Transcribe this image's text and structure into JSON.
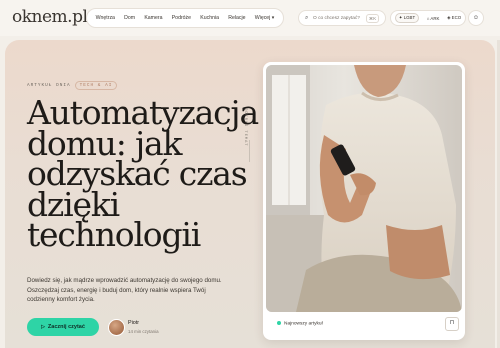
{
  "header": {
    "logo": "oknem.pl",
    "nav": [
      "Wnętrza",
      "Dom",
      "Kamera",
      "Podróże",
      "Kuchnia",
      "Relacje",
      "Więcej ▾"
    ],
    "search_placeholder": "O co chcesz zapytać?",
    "search_shortcut": "⌘K",
    "quick_pills": [
      "LGBT",
      "ARK",
      "ECO"
    ],
    "icons": [
      "search-icon",
      "sparkle-icon",
      "user-icon"
    ]
  },
  "hero": {
    "kicker": "ARTYKUŁ DNIA",
    "tag": "TECH & AI",
    "headline": "Automatyzacja domu: jak odzyskać czas dzięki technologii",
    "lede": "Dowiedz się, jak mądrze wprowadzić automatyzację do swojego domu. Oszczędzaj czas, energię i buduj dom, który realnie wspiera Twój codzienny komfort życia.",
    "cta_label": "Zacznij czytać",
    "author_name": "Piotr",
    "author_meta": "14 min czytania",
    "vertical_label": "ODKRYJ TEMAT"
  },
  "feature": {
    "label": "Najnowszy artykuł",
    "bookmark_icon": "bookmark-icon"
  },
  "colors": {
    "accent": "#2ed4a6",
    "tag": "#b17e65"
  }
}
